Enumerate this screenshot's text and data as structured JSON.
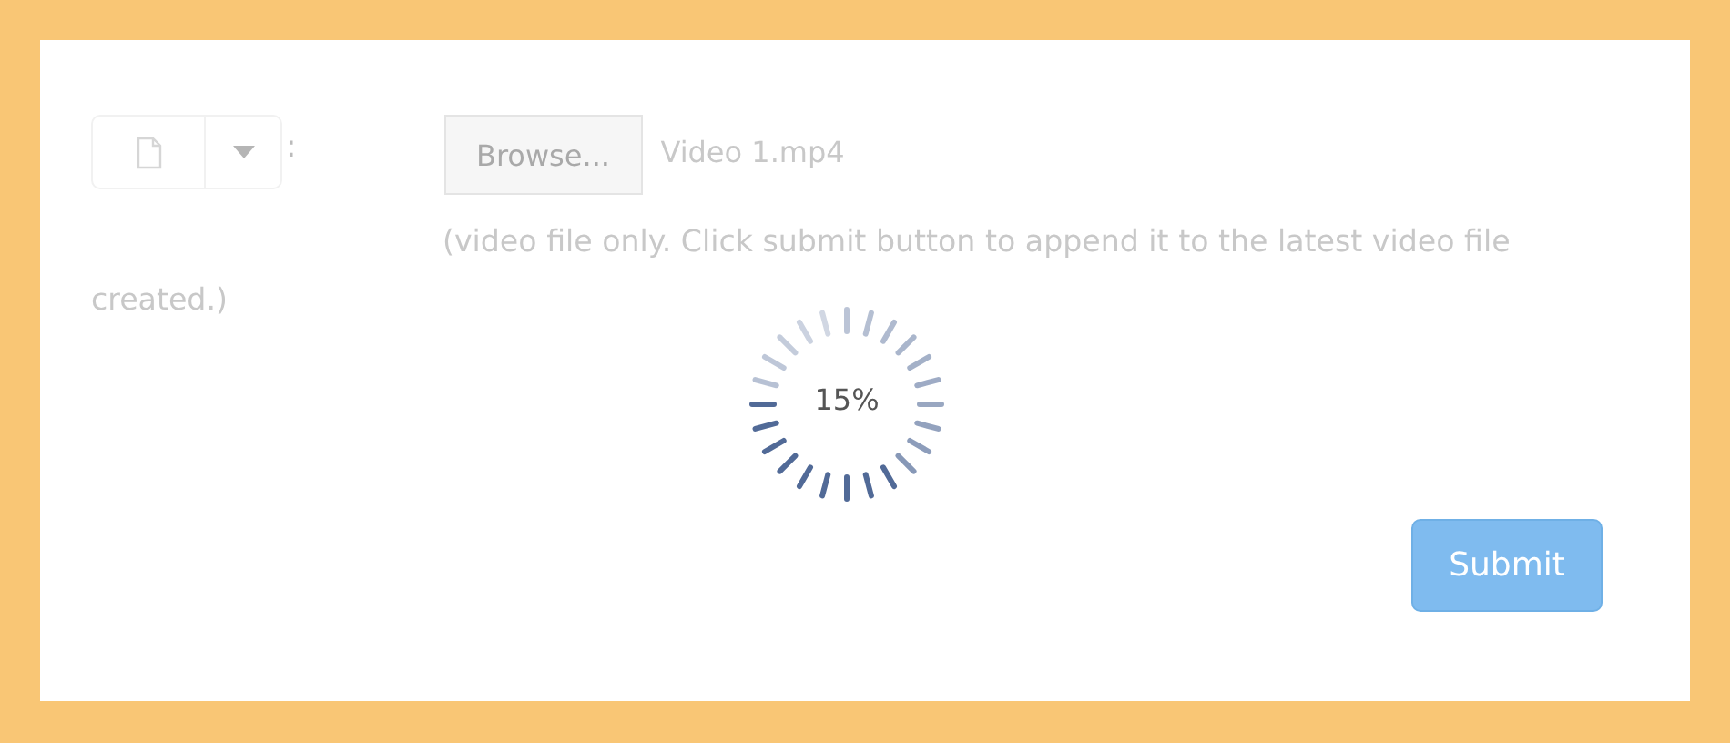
{
  "form": {
    "separator": ":",
    "browse_button": {
      "label": "Browse..."
    },
    "file_name": "Video 1.mp4",
    "hint": "(video file only. Click submit button to append it to the latest video file created.)",
    "progress": {
      "label": "15%"
    },
    "submit_button": {
      "label": "Submit",
      "disabled": true
    }
  }
}
